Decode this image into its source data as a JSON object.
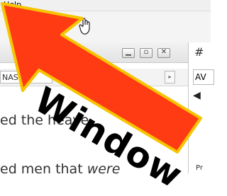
{
  "menubar": {
    "help_label": "Help"
  },
  "panel": {
    "version_label": "NAS",
    "verse_line_1": "ed the heave",
    "verse_line_2_prefix": "ed men that ",
    "verse_line_2_italic": "were"
  },
  "right_panel": {
    "hash_label": "#",
    "box_text": "AV",
    "bottom_label": "Pr"
  },
  "overlay": {
    "label": "Window",
    "fill_color": "#ff3b14",
    "outline_color": "#f6c400"
  }
}
